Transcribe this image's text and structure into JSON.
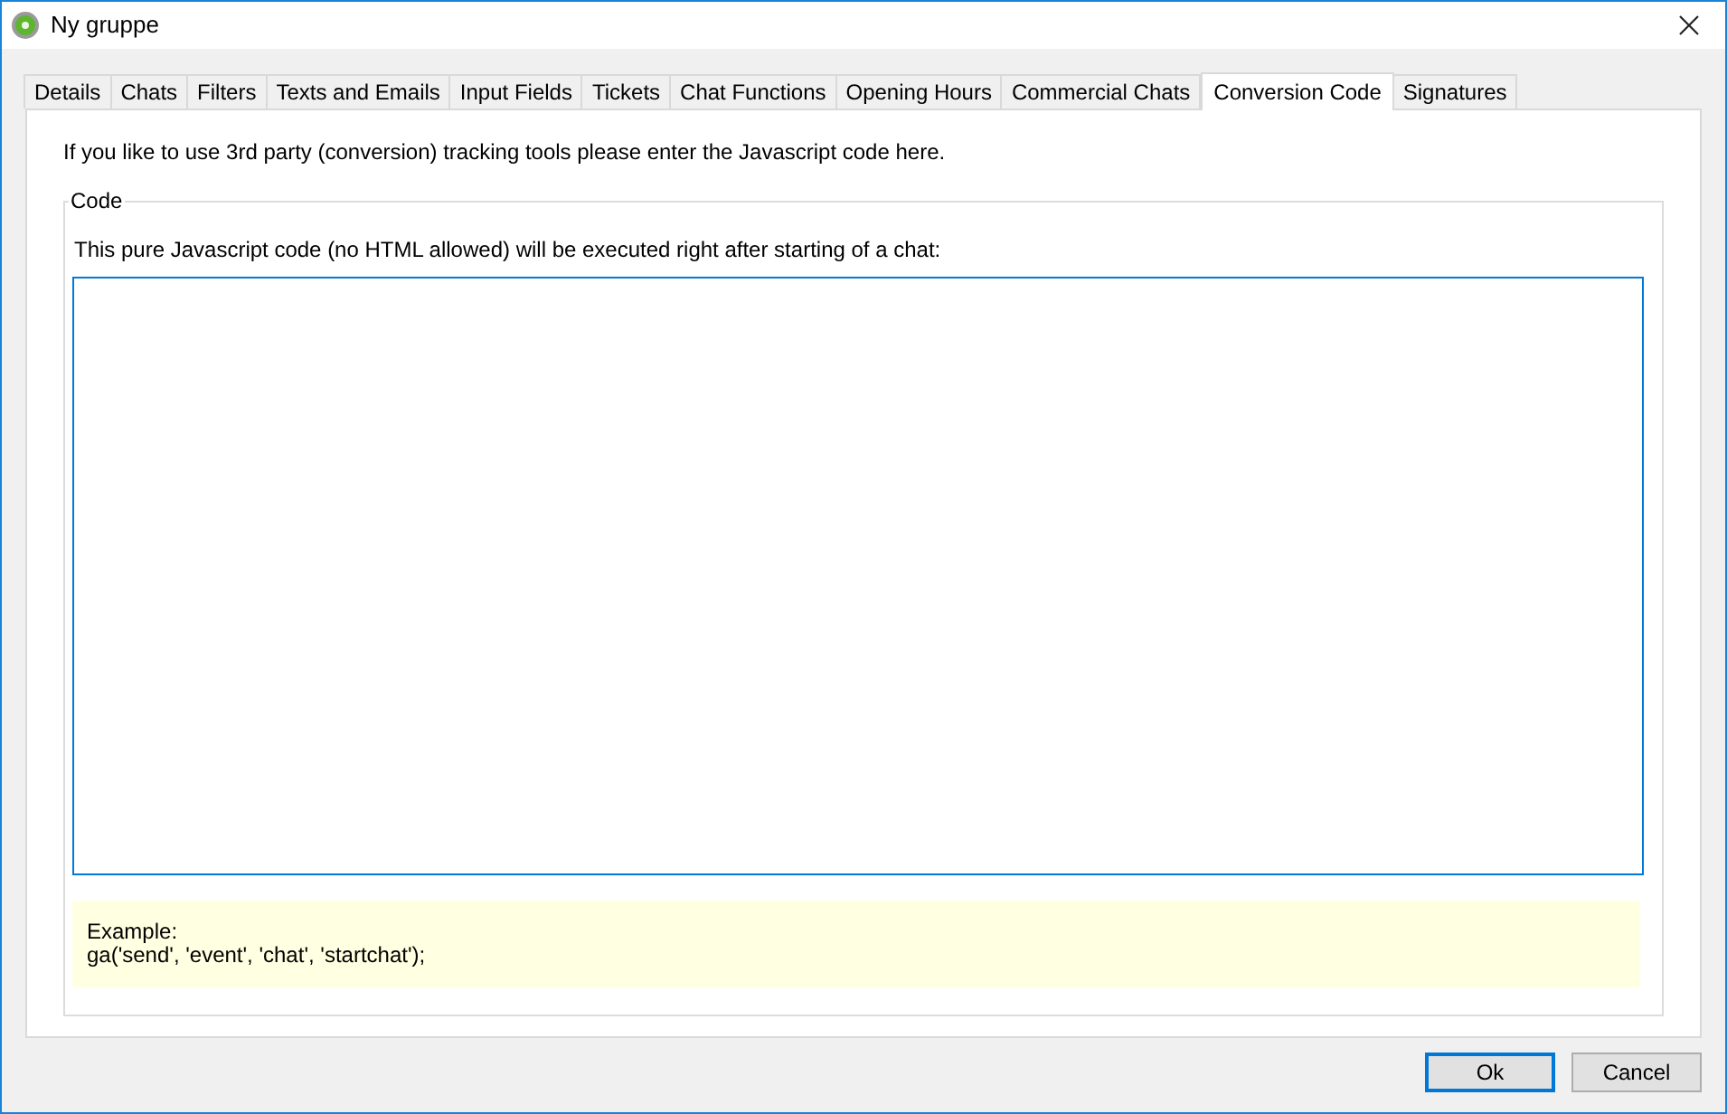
{
  "window": {
    "title": "Ny gruppe"
  },
  "tabs": [
    {
      "label": "Details",
      "selected": false
    },
    {
      "label": "Chats",
      "selected": false
    },
    {
      "label": "Filters",
      "selected": false
    },
    {
      "label": "Texts and Emails",
      "selected": false
    },
    {
      "label": "Input Fields",
      "selected": false
    },
    {
      "label": "Tickets",
      "selected": false
    },
    {
      "label": "Chat Functions",
      "selected": false
    },
    {
      "label": "Opening Hours",
      "selected": false
    },
    {
      "label": "Commercial Chats",
      "selected": false
    },
    {
      "label": "Conversion Code",
      "selected": true
    },
    {
      "label": "Signatures",
      "selected": false
    }
  ],
  "intro": "If you like to use 3rd party (conversion) tracking tools please enter the Javascript code here.",
  "code_group": {
    "title": "Code",
    "description": "This pure Javascript code (no HTML allowed) will be executed right after starting of a chat:",
    "example_lines": [
      "Example:",
      "ga('send', 'event', 'chat', 'startchat');"
    ]
  },
  "buttons": [
    {
      "label": "Ok",
      "default": true
    },
    {
      "label": "Cancel",
      "default": false
    }
  ]
}
